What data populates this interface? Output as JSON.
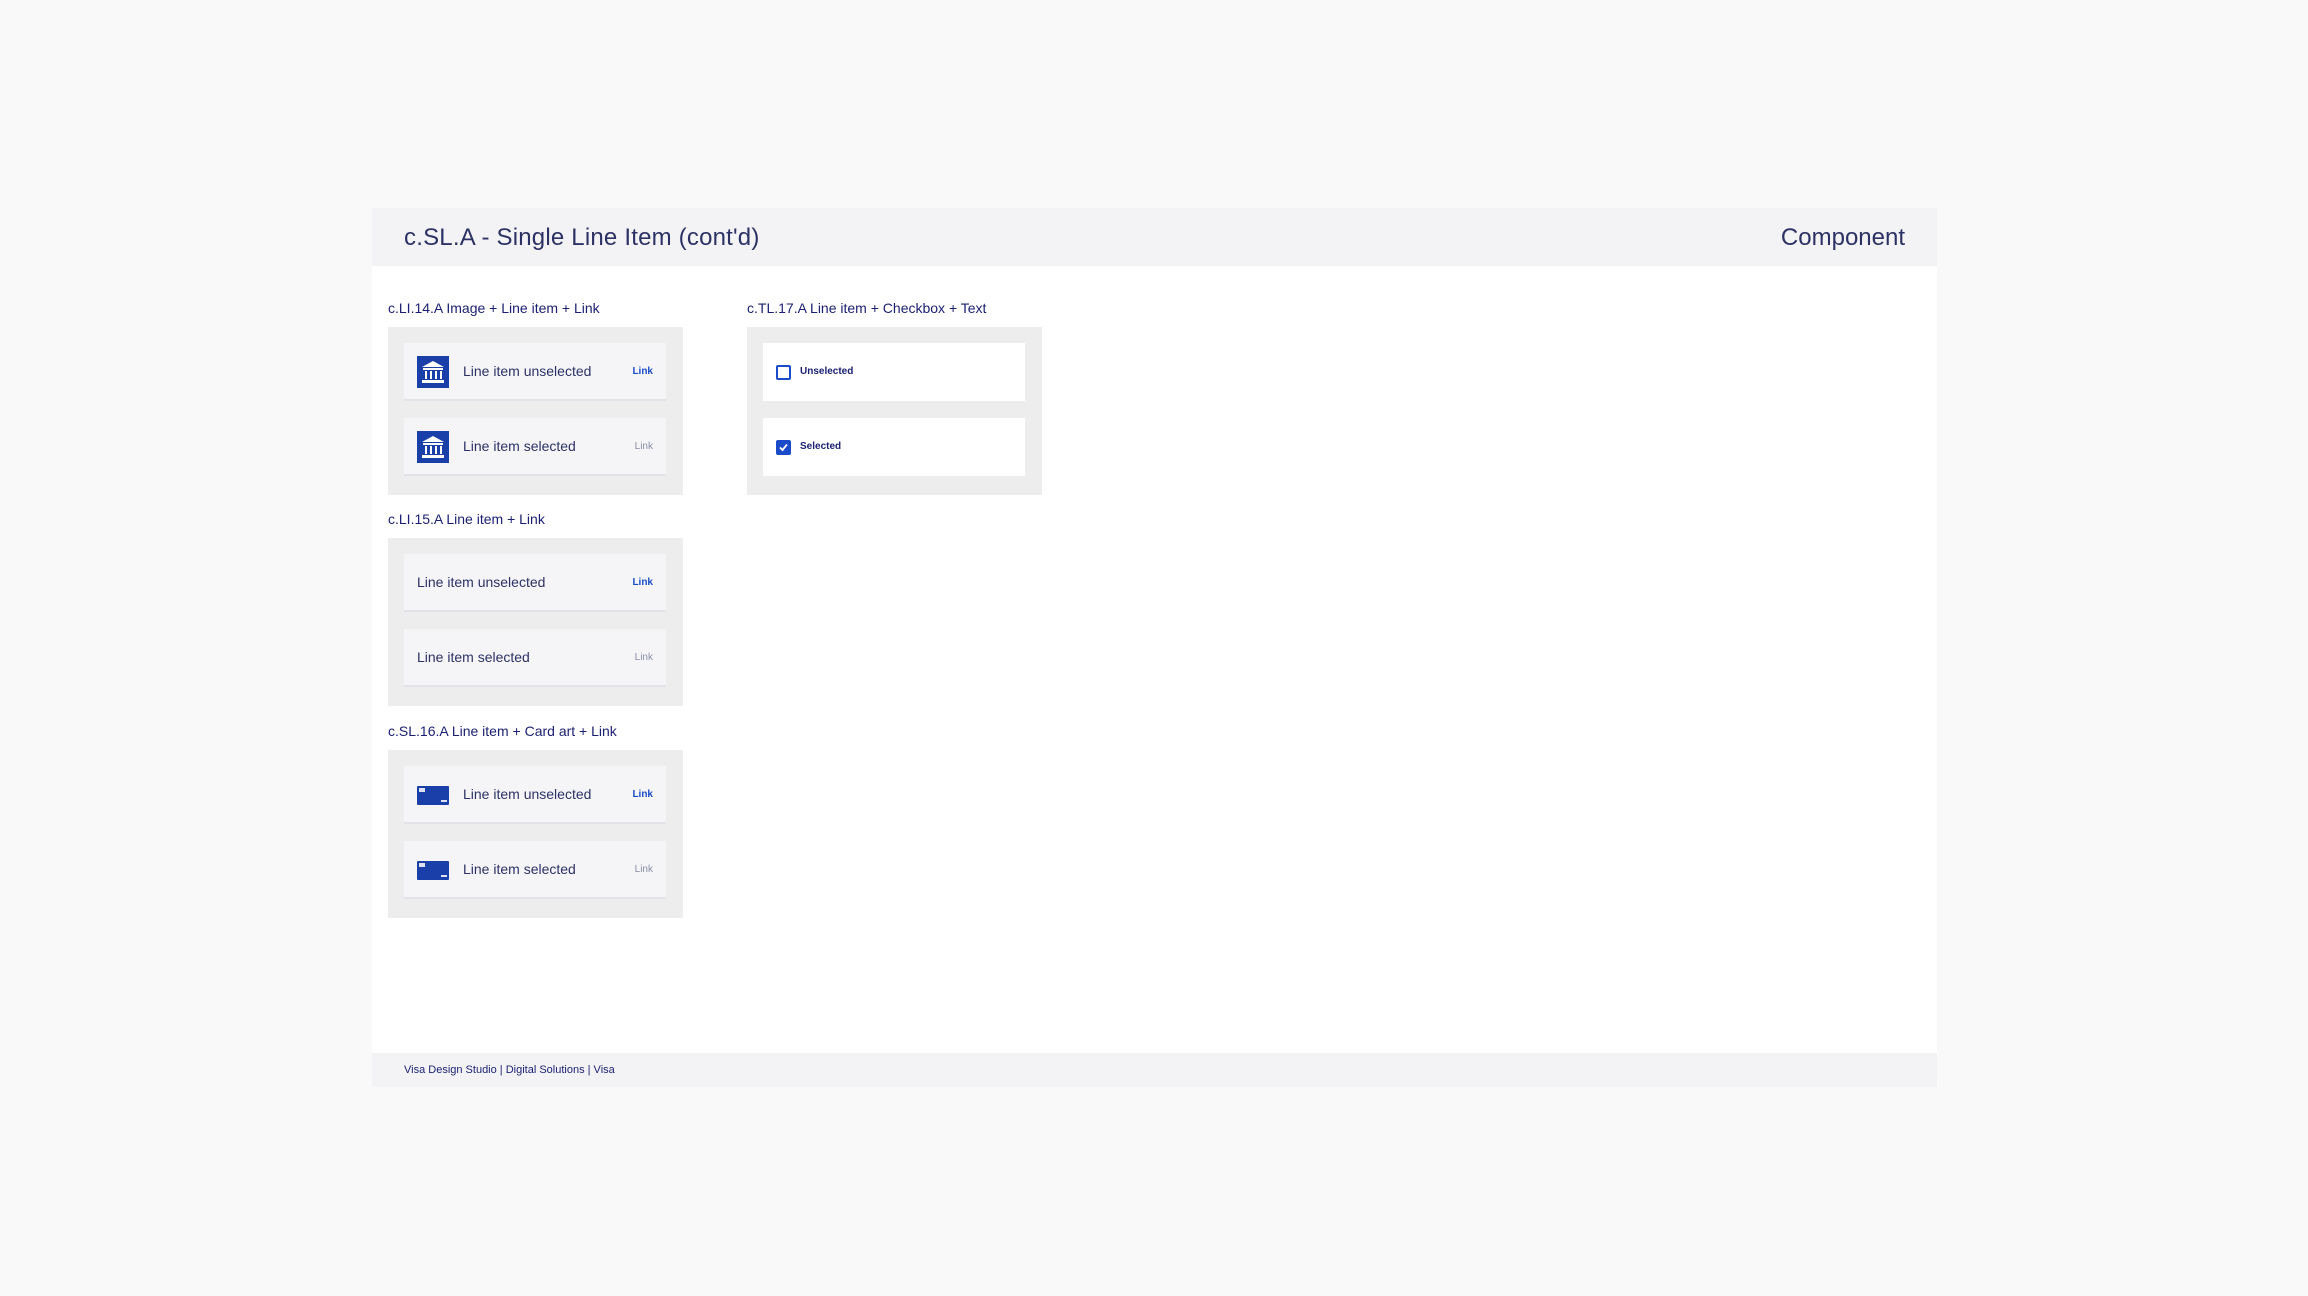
{
  "header": {
    "title": "c.SL.A - Single Line Item (cont'd)",
    "kind": "Component"
  },
  "footer": {
    "text": "Visa Design Studio | Digital Solutions | Visa"
  },
  "sections": {
    "s14": {
      "label": "c.LI.14.A Image + Line item + Link",
      "row1": {
        "label": "Line item unselected",
        "link": "Link",
        "image": "bank-logo-icon"
      },
      "row2": {
        "label": "Line item selected",
        "link": "Link",
        "image": "bank-logo-icon"
      }
    },
    "s15": {
      "label": "c.LI.15.A Line item + Link",
      "row1": {
        "label": "Line item unselected",
        "link": "Link"
      },
      "row2": {
        "label": "Line item selected",
        "link": "Link"
      }
    },
    "s16": {
      "label": "c.SL.16.A Line item + Card art + Link",
      "row1": {
        "label": "Line item unselected",
        "link": "Link",
        "image": "card-art-icon"
      },
      "row2": {
        "label": "Line item selected",
        "link": "Link",
        "image": "card-art-icon"
      }
    },
    "s17": {
      "label": "c.TL.17.A Line item + Checkbox + Text",
      "row1": {
        "label": "Unselected",
        "checked": false
      },
      "row2": {
        "label": "Selected",
        "checked": true
      }
    }
  },
  "colors": {
    "brand_blue": "#1a4cc9",
    "navy": "#1a1f71",
    "muted_link": "#8a8ea8",
    "panel": "#ededed"
  }
}
